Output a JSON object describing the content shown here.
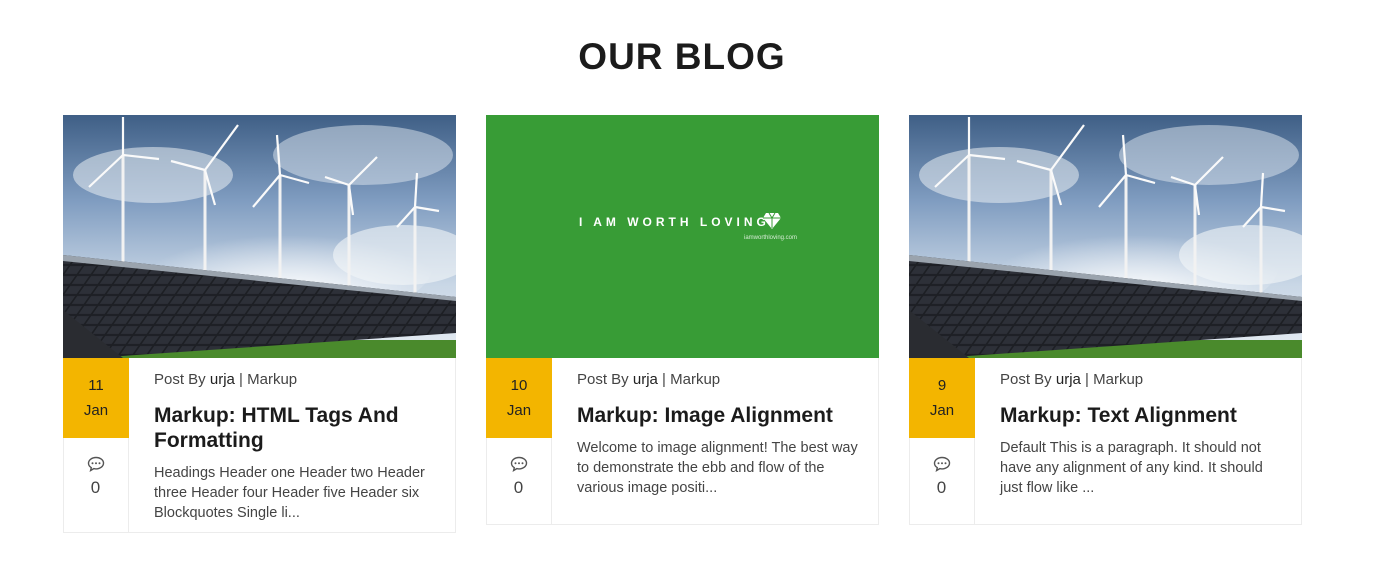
{
  "section": {
    "title": "OUR BLOG"
  },
  "posts": [
    {
      "day": "11",
      "month": "Jan",
      "byline_prefix": "Post By ",
      "author": "urja",
      "separator": " | ",
      "category": "Markup",
      "title": "Markup: HTML Tags And Formatting",
      "excerpt": "Headings Header one Header two Header three Header four Header five Header six Blockquotes Single li...",
      "comments": "0",
      "image": "wind-turbines-solar-panels"
    },
    {
      "day": "10",
      "month": "Jan",
      "byline_prefix": "Post By ",
      "author": "urja",
      "separator": " | ",
      "category": "Markup",
      "title": "Markup: Image Alignment",
      "excerpt": "Welcome to image alignment! The best way to demonstrate the ebb and flow of the various image positi...",
      "comments": "0",
      "image": "green-banner",
      "image_text": "I AM WORTH LOVING",
      "image_subtext": "iamworthloving.com",
      "image_bg": "#389c36"
    },
    {
      "day": "9",
      "month": "Jan",
      "byline_prefix": "Post By ",
      "author": "urja",
      "separator": " | ",
      "category": "Markup",
      "title": "Markup: Text Alignment",
      "excerpt": "Default This is a paragraph. It should not have any alignment of any kind. It should just flow like ...",
      "comments": "0",
      "image": "wind-turbines-solar-panels"
    }
  ],
  "colors": {
    "date_badge": "#f3b500",
    "title": "#1b1b1b",
    "border": "#ececec"
  },
  "icons": {
    "comment": "speech-bubble-icon"
  }
}
